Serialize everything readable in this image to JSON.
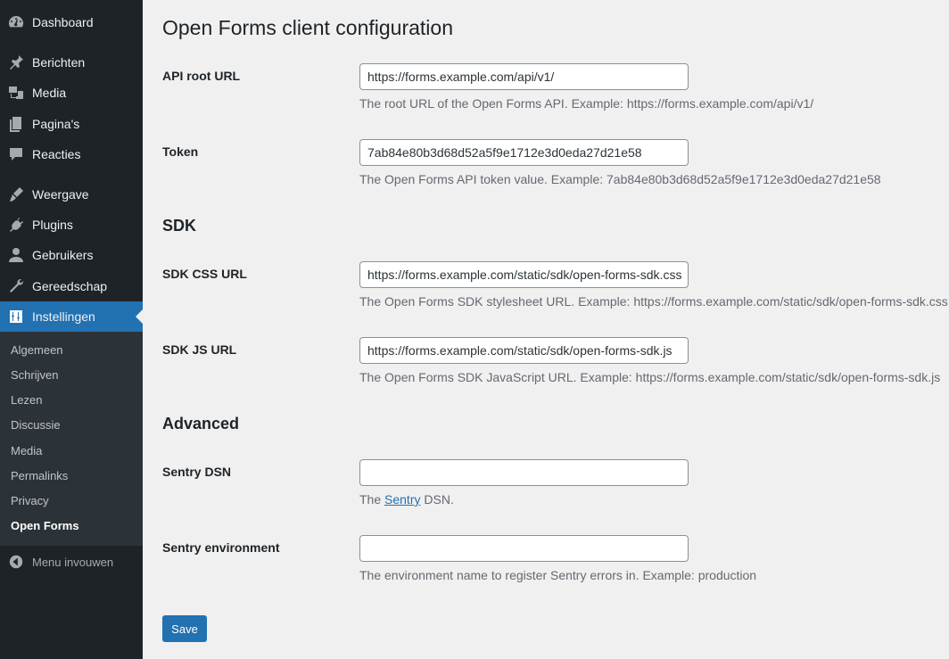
{
  "sidebar": {
    "items": [
      {
        "label": "Dashboard",
        "icon": "dashboard-icon"
      },
      {
        "label": "Berichten",
        "icon": "pushpin-icon"
      },
      {
        "label": "Media",
        "icon": "media-icon"
      },
      {
        "label": "Pagina's",
        "icon": "pages-icon"
      },
      {
        "label": "Reacties",
        "icon": "comments-icon"
      },
      {
        "label": "Weergave",
        "icon": "appearance-icon"
      },
      {
        "label": "Plugins",
        "icon": "plugins-icon"
      },
      {
        "label": "Gebruikers",
        "icon": "users-icon"
      },
      {
        "label": "Gereedschap",
        "icon": "tools-icon"
      },
      {
        "label": "Instellingen",
        "icon": "settings-icon",
        "active": true
      }
    ],
    "submenu": [
      {
        "label": "Algemeen"
      },
      {
        "label": "Schrijven"
      },
      {
        "label": "Lezen"
      },
      {
        "label": "Discussie"
      },
      {
        "label": "Media"
      },
      {
        "label": "Permalinks"
      },
      {
        "label": "Privacy"
      },
      {
        "label": "Open Forms",
        "current": true
      }
    ],
    "collapse_label": "Menu invouwen",
    "colors": {
      "background": "#1d2327",
      "active": "#2271b1",
      "submenu_bg": "#2c3338"
    }
  },
  "page": {
    "title": "Open Forms client configuration",
    "fields": {
      "api_root": {
        "label": "API root URL",
        "value": "https://forms.example.com/api/v1/",
        "description": "The root URL of the Open Forms API. Example: https://forms.example.com/api/v1/"
      },
      "token": {
        "label": "Token",
        "value": "7ab84e80b3d68d52a5f9e1712e3d0eda27d21e58",
        "description": "The Open Forms API token value. Example: 7ab84e80b3d68d52a5f9e1712e3d0eda27d21e58"
      }
    },
    "sdk": {
      "heading": "SDK",
      "css_url": {
        "label": "SDK CSS URL",
        "value": "https://forms.example.com/static/sdk/open-forms-sdk.css",
        "description": "The Open Forms SDK stylesheet URL. Example: https://forms.example.com/static/sdk/open-forms-sdk.css"
      },
      "js_url": {
        "label": "SDK JS URL",
        "value": "https://forms.example.com/static/sdk/open-forms-sdk.js",
        "description": "The Open Forms SDK JavaScript URL. Example: https://forms.example.com/static/sdk/open-forms-sdk.js"
      }
    },
    "advanced": {
      "heading": "Advanced",
      "sentry_dsn": {
        "label": "Sentry DSN",
        "value": "",
        "desc_prefix": "The ",
        "desc_link": "Sentry",
        "desc_suffix": " DSN."
      },
      "sentry_env": {
        "label": "Sentry environment",
        "value": "",
        "description": "The environment name to register Sentry errors in. Example: production"
      }
    },
    "save_label": "Save"
  }
}
